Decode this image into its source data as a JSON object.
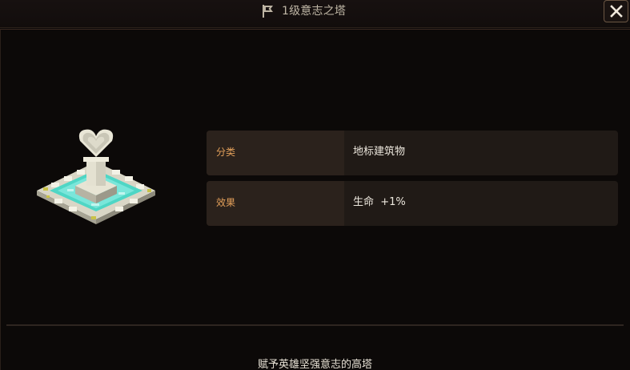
{
  "window": {
    "title": "1级意志之塔",
    "title_icon": "flag-icon",
    "close_icon": "close-icon"
  },
  "building": {
    "image_icon": "heart-fountain-icon",
    "attributes": [
      {
        "label": "分类",
        "value": "地标建筑物"
      },
      {
        "label": "效果",
        "value": "生命  +1%"
      }
    ],
    "description": "赋予英雄坚强意志的高塔"
  },
  "colors": {
    "background": "#0c0909",
    "label_accent": "#e3a05a",
    "value_text": "#ece7dd",
    "row_bg": "#201a16",
    "label_cell_bg": "#2b221c",
    "border": "#6a5643"
  }
}
